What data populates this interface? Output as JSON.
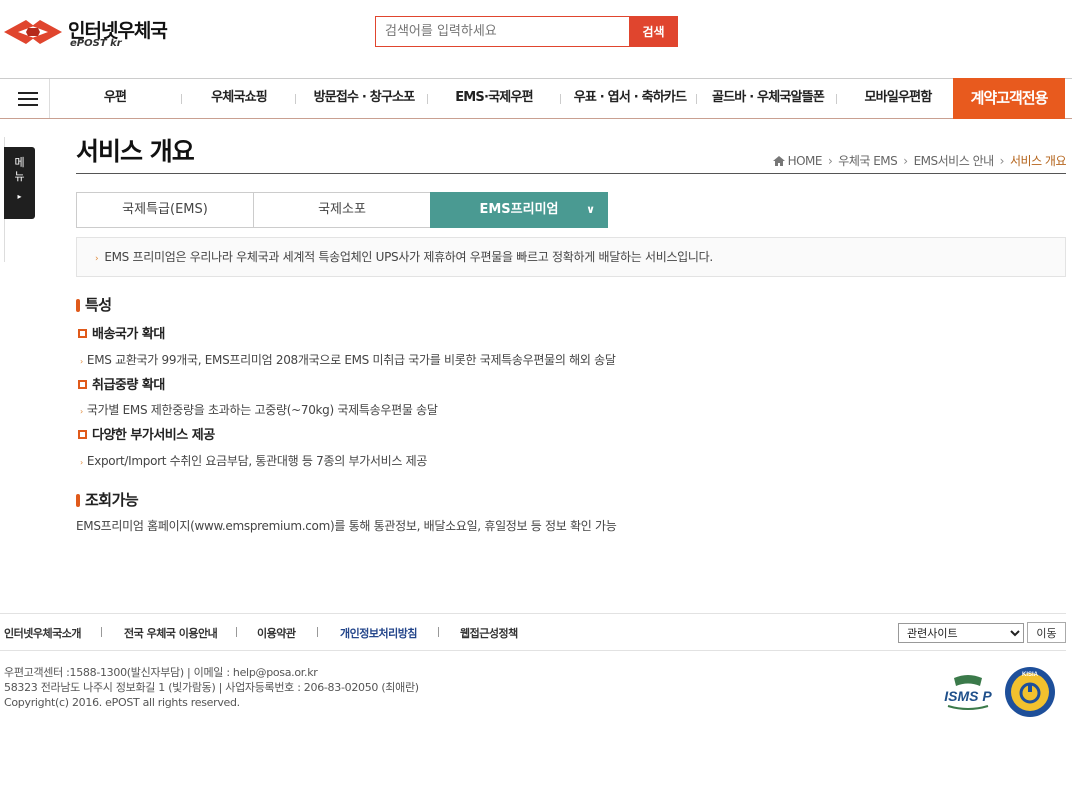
{
  "header": {
    "logo_title": "인터넷우체국",
    "logo_sub": "ePOST kr",
    "search_placeholder": "검색어를 입력하세요",
    "search_button": "검색"
  },
  "gnb": {
    "items": [
      "우편",
      "우체국쇼핑",
      "방문접수 · 창구소포",
      "EMS·국제우편",
      "우표 · 엽서 · 축하카드",
      "골드바 · 우체국알뜰폰",
      "모바일우편함"
    ],
    "special": "계약고객전용"
  },
  "side_tab": {
    "label_1": "메",
    "label_2": "뉴",
    "arrow": "▸"
  },
  "page": {
    "title": "서비스 개요",
    "breadcrumb": [
      "HOME",
      "우체국 EMS",
      "EMS서비스 안내",
      "서비스 개요"
    ]
  },
  "tabs": [
    {
      "label": "국제특급(EMS)"
    },
    {
      "label": "국제소포"
    },
    {
      "label": "EMS프리미엄",
      "active": true
    }
  ],
  "info": "EMS 프리미엄은 우리나라 우체국과 세계적 특송업체인 UPS사가 제휴하여 우편물을 빠르고 정확하게 배달하는 서비스입니다.",
  "features": {
    "title": "특성",
    "items": [
      {
        "title": "배송국가 확대",
        "desc": "EMS 교환국가 99개국, EMS프리미엄 208개국으로 EMS 미취급 국가를 비롯한 국제특송우편물의 해외 송달"
      },
      {
        "title": "취급중량 확대",
        "desc": "국가별 EMS 제한중량을 초과하는 고중량(~70kg) 국제특송우편물 송달"
      },
      {
        "title": "다양한 부가서비스 제공",
        "desc": "Export/Import 수취인 요금부담, 통관대행 등 7종의 부가서비스 제공"
      }
    ]
  },
  "inquiry": {
    "title": "조회가능",
    "desc": "EMS프리미엄 홈페이지(www.emspremium.com)를 통해 통관정보, 배달소요일, 휴일정보 등 정보 확인 가능"
  },
  "footer": {
    "links": [
      "인터넷우체국소개",
      "전국 우체국 이용안내",
      "이용약관",
      "개인정보처리방침",
      "웹접근성정책"
    ],
    "select_value": "관련사이트",
    "move_button": "이동",
    "info_line1": "우편고객센터 :1588-1300(발신자부담)   |   이메일 : help@posa.or.kr",
    "info_line2": "58323 전라남도 나주시 정보화길 1 (빛가람동)   |   사업자등록번호 : 206-83-02050 (최애란)",
    "copyright": "Copyright(c) 2016. ePOST all rights reserved.",
    "cert1": "ISMS P",
    "cert2": "KISIA"
  },
  "colors": {
    "brand_red": "#e0452e",
    "special_orange": "#e85a1e",
    "tab_active": "#4a9a92"
  }
}
